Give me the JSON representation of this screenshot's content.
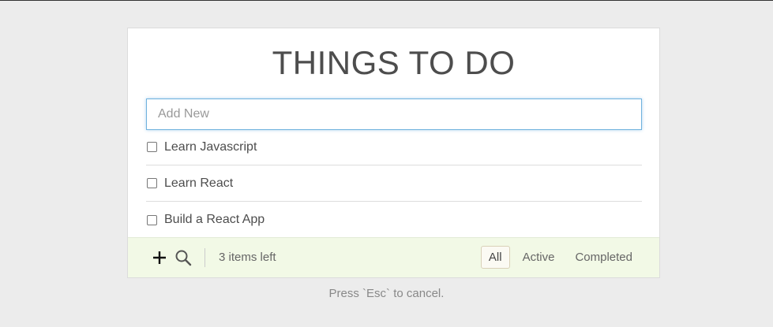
{
  "app": {
    "title": "THINGS TO DO"
  },
  "new_todo": {
    "placeholder": "Add New",
    "value": ""
  },
  "todos": [
    {
      "label": "Learn Javascript",
      "completed": false
    },
    {
      "label": "Learn React",
      "completed": false
    },
    {
      "label": "Build a React App",
      "completed": false
    }
  ],
  "footer": {
    "add_icon": "plus-icon",
    "search_icon": "search-icon",
    "items_left": "3 items left",
    "filters": [
      {
        "label": "All",
        "selected": true
      },
      {
        "label": "Active",
        "selected": false
      },
      {
        "label": "Completed",
        "selected": false
      }
    ]
  },
  "hint": "Press `Esc` to cancel.",
  "colors": {
    "background": "#ececec",
    "footer_background": "#f2f9e6",
    "input_focus_border": "#6fb2de"
  }
}
